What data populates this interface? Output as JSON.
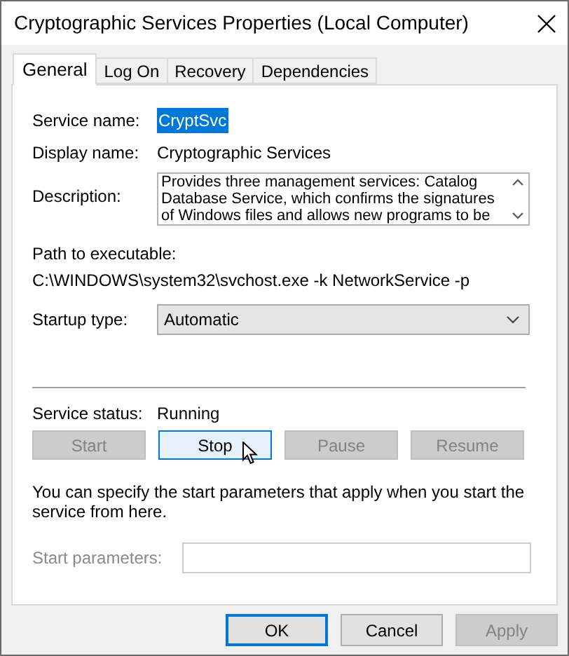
{
  "window": {
    "title": "Cryptographic Services Properties (Local Computer)"
  },
  "tabs": [
    {
      "label": "General",
      "selected": true
    },
    {
      "label": "Log On",
      "selected": false
    },
    {
      "label": "Recovery",
      "selected": false
    },
    {
      "label": "Dependencies",
      "selected": false
    }
  ],
  "service_name": {
    "label": "Service name:",
    "value": "CryptSvc",
    "selected": true
  },
  "display_name": {
    "label": "Display name:",
    "value": "Cryptographic Services"
  },
  "description": {
    "label": "Description:",
    "value": "Provides three management services: Catalog Database Service, which confirms the signatures of Windows files and allows new programs to be"
  },
  "path": {
    "label": "Path to executable:",
    "value": "C:\\WINDOWS\\system32\\svchost.exe -k NetworkService -p"
  },
  "startup_type": {
    "label": "Startup type:",
    "value": "Automatic"
  },
  "service_status": {
    "label": "Service status:",
    "value": "Running"
  },
  "service_buttons": [
    {
      "label": "Start",
      "disabled": true,
      "hovered": false
    },
    {
      "label": "Stop",
      "disabled": false,
      "hovered": true
    },
    {
      "label": "Pause",
      "disabled": true,
      "hovered": false
    },
    {
      "label": "Resume",
      "disabled": true,
      "hovered": false
    }
  ],
  "hint": "You can specify the start parameters that apply when you start the service from here.",
  "start_parameters": {
    "label": "Start parameters:",
    "disabled": true
  },
  "dialog_buttons": [
    {
      "label": "OK",
      "default": true,
      "disabled": false
    },
    {
      "label": "Cancel",
      "default": false,
      "disabled": false
    },
    {
      "label": "Apply",
      "default": false,
      "disabled": true
    }
  ]
}
